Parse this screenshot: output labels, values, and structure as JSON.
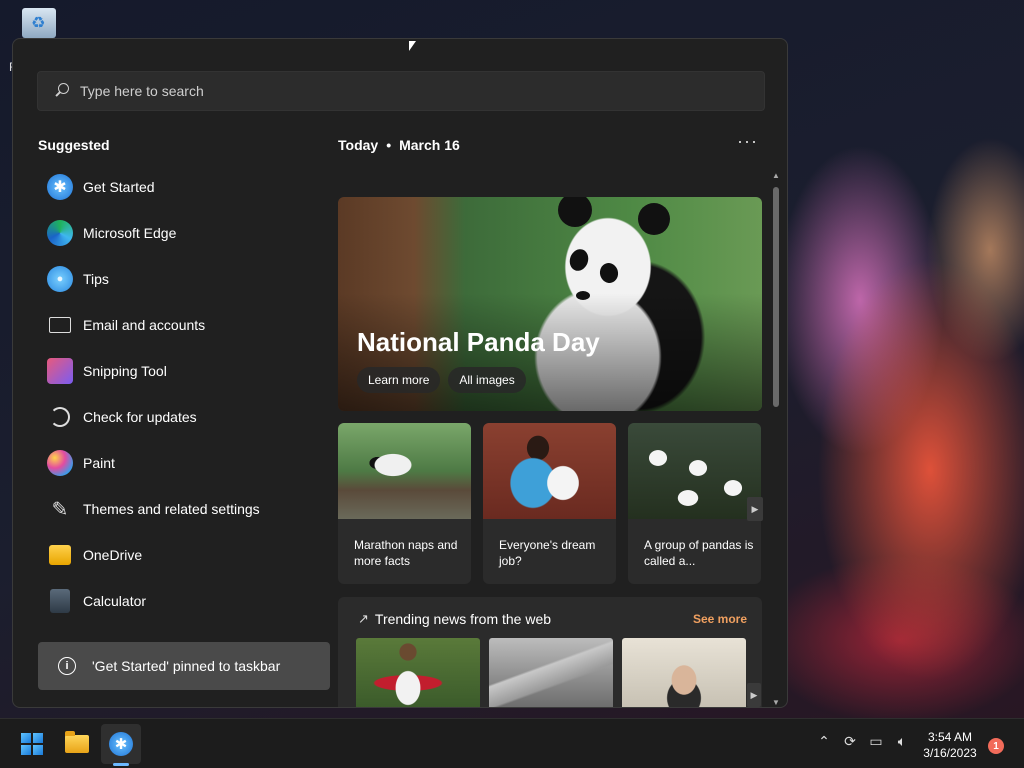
{
  "desktop": {
    "recycle_bin_label": "R"
  },
  "search": {
    "placeholder": "Type here to search"
  },
  "suggested": {
    "title": "Suggested",
    "items": [
      {
        "label": "Get Started",
        "icon": "get-started-icon"
      },
      {
        "label": "Microsoft Edge",
        "icon": "edge-icon"
      },
      {
        "label": "Tips",
        "icon": "tips-icon"
      },
      {
        "label": "Email and accounts",
        "icon": "mail-icon"
      },
      {
        "label": "Snipping Tool",
        "icon": "snipping-tool-icon"
      },
      {
        "label": "Check for updates",
        "icon": "update-icon"
      },
      {
        "label": "Paint",
        "icon": "paint-icon"
      },
      {
        "label": "Themes and related settings",
        "icon": "brush-icon"
      },
      {
        "label": "OneDrive",
        "icon": "onedrive-icon"
      },
      {
        "label": "Calculator",
        "icon": "calculator-icon"
      }
    ]
  },
  "toast": {
    "message": "'Get Started' pinned to taskbar"
  },
  "feed": {
    "today": "Today",
    "bullet": "•",
    "date": "March 16",
    "more": "···",
    "hero": {
      "title": "National Panda Day",
      "learn_more": "Learn more",
      "all_images": "All images"
    },
    "cards": [
      {
        "text": "Marathon naps and more facts"
      },
      {
        "text": "Everyone's dream job?"
      },
      {
        "text": "A group of pandas is called a..."
      }
    ],
    "trending": {
      "title": "Trending news from the web",
      "see_more": "See more"
    }
  },
  "taskbar": {
    "time": "3:54 AM",
    "date": "3/16/2023",
    "notification_count": "1"
  },
  "colors": {
    "panel_bg": "#202020",
    "accent": "#6bb8ff",
    "see_more": "#f0a060",
    "notification_badge": "#f26b5a"
  }
}
